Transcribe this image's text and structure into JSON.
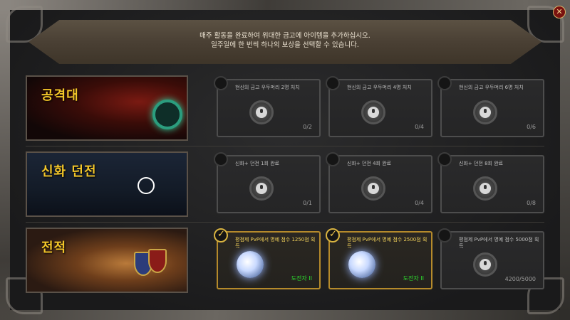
{
  "header": {
    "line1": "매주 활동을 완료하여 위대한 금고에 아이템을 추가하십시오.",
    "line2": "일주일에 한 번씩 하나의 보상을 선택할 수 있습니다."
  },
  "close_label": "✕",
  "rows": [
    {
      "title": "공격대",
      "slots": [
        {
          "label": "현신의 금고 우두머리 2명 처치",
          "value": "0/2",
          "completed": false
        },
        {
          "label": "현신의 금고 우두머리 4명 처치",
          "value": "0/4",
          "completed": false
        },
        {
          "label": "현신의 금고 우두머리 6명 처치",
          "value": "0/6",
          "completed": false
        }
      ]
    },
    {
      "title": "신화 던전",
      "slots": [
        {
          "label": "신화+ 던전 1회 완료",
          "value": "0/1",
          "completed": false
        },
        {
          "label": "신화+ 던전 4회 완료",
          "value": "0/4",
          "completed": false
        },
        {
          "label": "신화+ 던전 8회 완료",
          "value": "0/8",
          "completed": false
        }
      ]
    },
    {
      "title": "전적",
      "slots": [
        {
          "label": "평점제 PvP에서 명예 점수 1250점 획득",
          "value": "도전자 II",
          "completed": true
        },
        {
          "label": "평점제 PvP에서 명예 점수 2500점 획득",
          "value": "도전자 II",
          "completed": true
        },
        {
          "label": "평점제 PvP에서 명예 점수 5000점 획득",
          "value": "4200/5000",
          "completed": false
        }
      ]
    }
  ],
  "colors": {
    "title_gold": "#f3c629",
    "reward_green": "#2ddf2d",
    "completed_border": "#b58a2b"
  }
}
